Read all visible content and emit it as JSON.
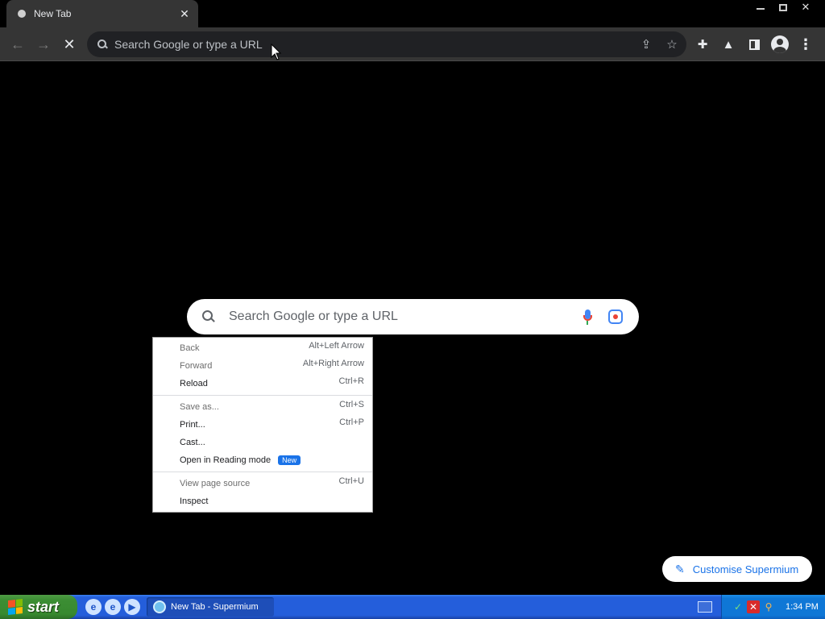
{
  "browser": {
    "tab": {
      "title": "New Tab"
    },
    "omnibox": {
      "placeholder": "Search Google or type a URL"
    }
  },
  "page": {
    "search": {
      "placeholder": "Search Google or type a URL"
    },
    "customise_button": "Customise Supermium"
  },
  "context_menu": {
    "items": [
      {
        "label": "Back",
        "shortcut": "Alt+Left Arrow",
        "enabled": false
      },
      {
        "label": "Forward",
        "shortcut": "Alt+Right Arrow",
        "enabled": false
      },
      {
        "label": "Reload",
        "shortcut": "Ctrl+R",
        "enabled": true
      },
      {
        "label": "Save as...",
        "shortcut": "Ctrl+S",
        "enabled": false
      },
      {
        "label": "Print...",
        "shortcut": "Ctrl+P",
        "enabled": true
      },
      {
        "label": "Cast...",
        "shortcut": "",
        "enabled": true
      },
      {
        "label": "Open in Reading mode",
        "shortcut": "",
        "enabled": true,
        "badge": "New"
      },
      {
        "label": "View page source",
        "shortcut": "Ctrl+U",
        "enabled": false
      },
      {
        "label": "Inspect",
        "shortcut": "",
        "enabled": true
      }
    ]
  },
  "taskbar": {
    "start_label": "start",
    "task_item": "New Tab - Supermium",
    "clock": "1:34 PM"
  },
  "colors": {
    "accent": "#1a73e8",
    "taskbar": "#245edb",
    "start": "#3c8e34"
  }
}
